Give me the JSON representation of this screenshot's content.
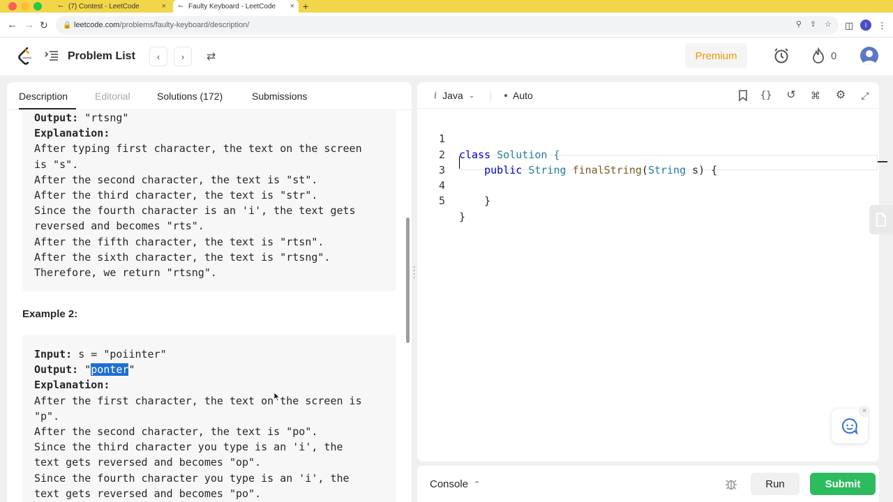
{
  "browser": {
    "tabs": [
      {
        "title": "(7) Contest - LeetCode"
      },
      {
        "title": "Faulty Keyboard - LeetCode"
      }
    ],
    "new_tab": "+",
    "close": "×",
    "url_host": "leetcode.com",
    "url_path": "/problems/faulty-keyboard/description/",
    "profile_initial": "I"
  },
  "header": {
    "problem_list": "Problem List",
    "premium": "Premium",
    "streak": "0"
  },
  "description_tabs": [
    {
      "label": "Description"
    },
    {
      "label": "Editorial"
    },
    {
      "label": "Solutions (172)"
    },
    {
      "label": "Submissions"
    }
  ],
  "example1": {
    "output_label": "Output:",
    "output_value": " \"rtsng\"",
    "explanation_label": "Explanation:",
    "lines": [
      "After typing first character, the text on the screen",
      "is \"s\".",
      "After the second character, the text is \"st\".",
      "After the third character, the text is \"str\".",
      "Since the fourth character is an 'i', the text gets",
      "reversed and becomes \"rts\".",
      "After the fifth character, the text is \"rtsn\".",
      "After the sixth character, the text is \"rtsng\".",
      "Therefore, we return \"rtsng\"."
    ]
  },
  "example2": {
    "title": "Example 2:",
    "input_label": "Input:",
    "input_value": " s = \"poiinter\"",
    "output_label": "Output:",
    "output_prefix": " \"",
    "output_selected": "ponter",
    "output_suffix": "\"",
    "explanation_label": "Explanation:",
    "lines": [
      "After the first character, the text on the screen is",
      "\"p\".",
      "After the second character, the text is \"po\".",
      "Since the third character you type is an 'i', the",
      "text gets reversed and becomes \"op\".",
      "Since the fourth character you type is an 'i', the",
      "text gets reversed and becomes \"po\"."
    ]
  },
  "editor": {
    "language": "Java",
    "language_prefix": "i",
    "mode": "Auto",
    "line_numbers": [
      "1",
      "2",
      "3",
      "4",
      "5"
    ],
    "code": {
      "l1_kw": "class",
      "l1_name": " Solution {",
      "l2_kw": "public",
      "l2_type": "String",
      "l2_fn": "finalString",
      "l2_param_type": "String",
      "l2_rest": " s) {",
      "l4": "}",
      "l5": "}"
    }
  },
  "console": {
    "label": "Console",
    "run": "Run",
    "submit": "Submit"
  },
  "colors": {
    "tabbar": "#f2d649",
    "premium": "#f29700",
    "submit": "#2cbb5d",
    "selection": "#1f6fd1"
  }
}
